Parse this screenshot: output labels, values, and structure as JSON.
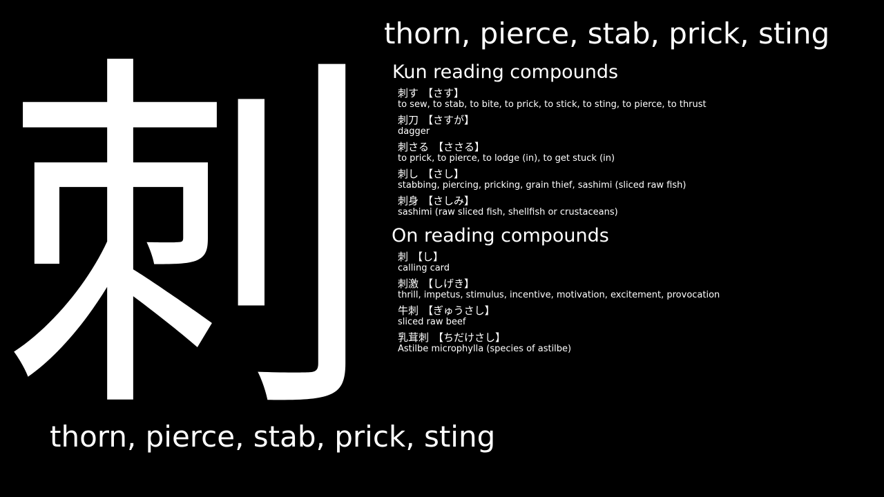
{
  "kanji": "刺",
  "meaning_top": "thorn, pierce, stab, prick, sting",
  "meaning_bottom": "thorn, pierce, stab, prick, sting",
  "kun": {
    "title": "Kun reading compounds",
    "entries": [
      {
        "word": "刺す",
        "reading": "【さす】",
        "definition": "to sew, to stab, to bite, to prick, to stick, to sting, to pierce, to thrust"
      },
      {
        "word": "刺刀",
        "reading": "【さすが】",
        "definition": "dagger"
      },
      {
        "word": "刺さる",
        "reading": "【ささる】",
        "definition": "to prick, to pierce, to lodge (in), to get stuck (in)"
      },
      {
        "word": "刺し",
        "reading": "【さし】",
        "definition": "stabbing, piercing, pricking, grain thief, sashimi (sliced raw fish)"
      },
      {
        "word": "刺身",
        "reading": "【さしみ】",
        "definition": "sashimi (raw sliced fish, shellfish or crustaceans)"
      }
    ]
  },
  "on": {
    "title": "On reading compounds",
    "entries": [
      {
        "word": "刺",
        "reading": "【し】",
        "definition": "calling card"
      },
      {
        "word": "刺激",
        "reading": "【しげき】",
        "definition": "thrill, impetus, stimulus, incentive, motivation, excitement, provocation"
      },
      {
        "word": "牛刺",
        "reading": "【ぎゅうさし】",
        "definition": "sliced raw beef"
      },
      {
        "word": "乳茸刺",
        "reading": "【ちだけさし】",
        "definition": "Astilbe microphylla (species of astilbe)"
      }
    ]
  },
  "colors": {
    "background": "#000000",
    "text": "#ffffff"
  }
}
